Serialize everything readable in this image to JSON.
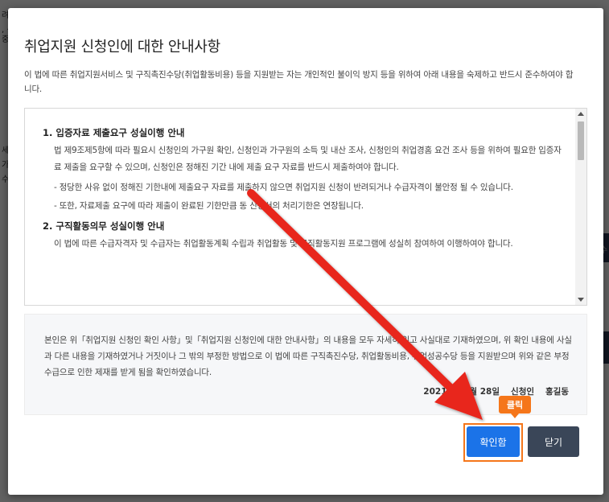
{
  "background": {
    "fragments": [
      "려",
      ", 신",
      "가 ·",
      "중",
      "세",
      "가 -",
      "수",
      "수"
    ]
  },
  "modal": {
    "title": "취업지원 신청인에 대한 안내사항",
    "description": "이 법에 따른 취업지원서비스 및 구직촉진수당(취업활동비용) 등을 지원받는 자는 개인적인 불이익 방지 등을 위하여 아래 내용을 숙제하고 반드시 준수하여야 합니다.",
    "notice": {
      "sections": [
        {
          "title": "1. 입증자료 제출요구 성실이행 안내",
          "body": "법 제9조제5항에 따라 필요시 신청인의 가구원 확인, 신청인과 가구원의 소득 및 내산 조사, 신청인의 취업경홈 요건 조사 등을 위하여 필요한 입증자료 제출을 요구할 수 있으며, 신청인은 정해진 기간 내에 제출 요구 자료를 반드시 제출하여야 합니다.",
          "bullets": [
            "- 정당한 사유 없이 정해진 기한내에 제출요구 자료를 제출하지 않으면 취업지원 신청이 반려되거나 수급자격이 불안정 될 수 있습니다.",
            "- 또한, 자료제출 요구에 따라 제출이 완료된 기한만큼 동 신청서의 처리기한은 연장됩니다."
          ]
        },
        {
          "title": "2. 구직활동의무 성실이행 안내",
          "body": "이 법에 따른 수급자격자 및 수급자는 취업활동계획 수립과 취업활동 및 구직활동지원 프로그램에 성실히 참여하여 이행하여야 합니다.",
          "bullets": []
        }
      ]
    },
    "confirmation": {
      "text": "본인은 위「취업지원 신청인 확인 사항」및「취업지원 신청인에 대한 안내사항」의 내용을 모두 자세히 읽고 사실대로 기재하였으며, 위 확인 내용에 사실과 다른 내용을 기재하였거나 거짓이나 그 밖의 부정한 방법으로 이 법에 따른 구직촉진수당, 취업활동비용, 취업성공수당 등을 지원받으며 위와 같은 부정수급으로 인한 제재를 받게 됨을 확인하였습니다.",
      "date": "2021년 12월 28일",
      "applicant_label": "신청인",
      "applicant_name": "홍길동"
    },
    "buttons": {
      "confirm": "확인함",
      "close": "닫기"
    },
    "callout": "클릭"
  },
  "colors": {
    "primary": "#1b73e8",
    "close_button": "#3a4658",
    "highlight": "#f5761a",
    "arrow": "#e8261f"
  },
  "icons": [
    "arrow-pointer-icon",
    "scroll-up-icon",
    "scroll-down-icon"
  ]
}
